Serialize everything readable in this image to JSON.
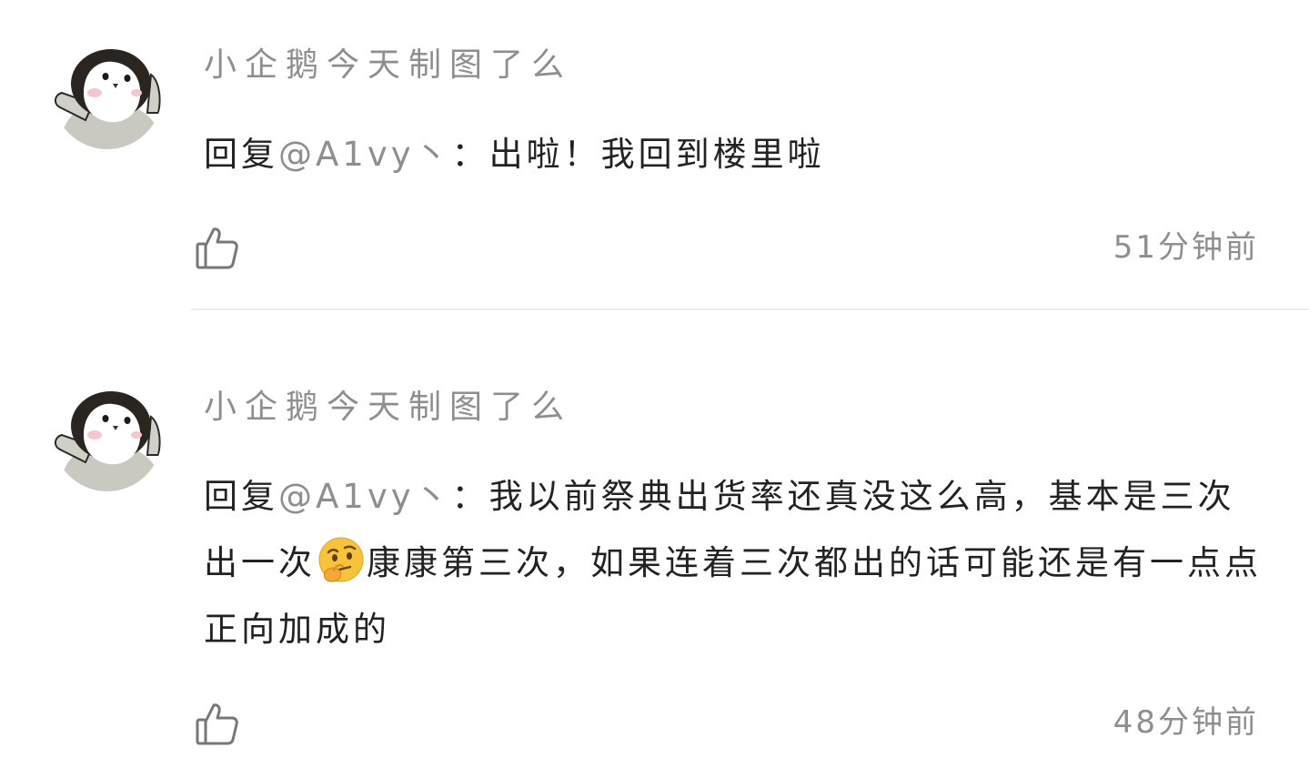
{
  "comments": [
    {
      "username": "小企鹅今天制图了么",
      "reply_prefix": "回复",
      "mention": "@A1vy丶",
      "separator": "：",
      "text": "出啦！我回到楼里啦",
      "time": "51分钟前"
    },
    {
      "username": "小企鹅今天制图了么",
      "reply_prefix": "回复",
      "mention": "@A1vy丶",
      "separator": "：",
      "text_before_emoji": "我以前祭典出货率还真没这么高，基本是三次出一次",
      "emoji": "thinking-face-emoji",
      "text_after_emoji": "康康第三次，如果连着三次都出的话可能还是有一点点正向加成的",
      "time": "48分钟前"
    }
  ],
  "icons": {
    "avatar": "penguin-avatar-icon",
    "like": "thumbs-up-icon"
  },
  "colors": {
    "username": "#8e8e8e",
    "body": "#222222",
    "mention": "#8e8e8e",
    "time": "#8e8e8e",
    "divider": "#ebebeb",
    "icon": "#777777"
  }
}
